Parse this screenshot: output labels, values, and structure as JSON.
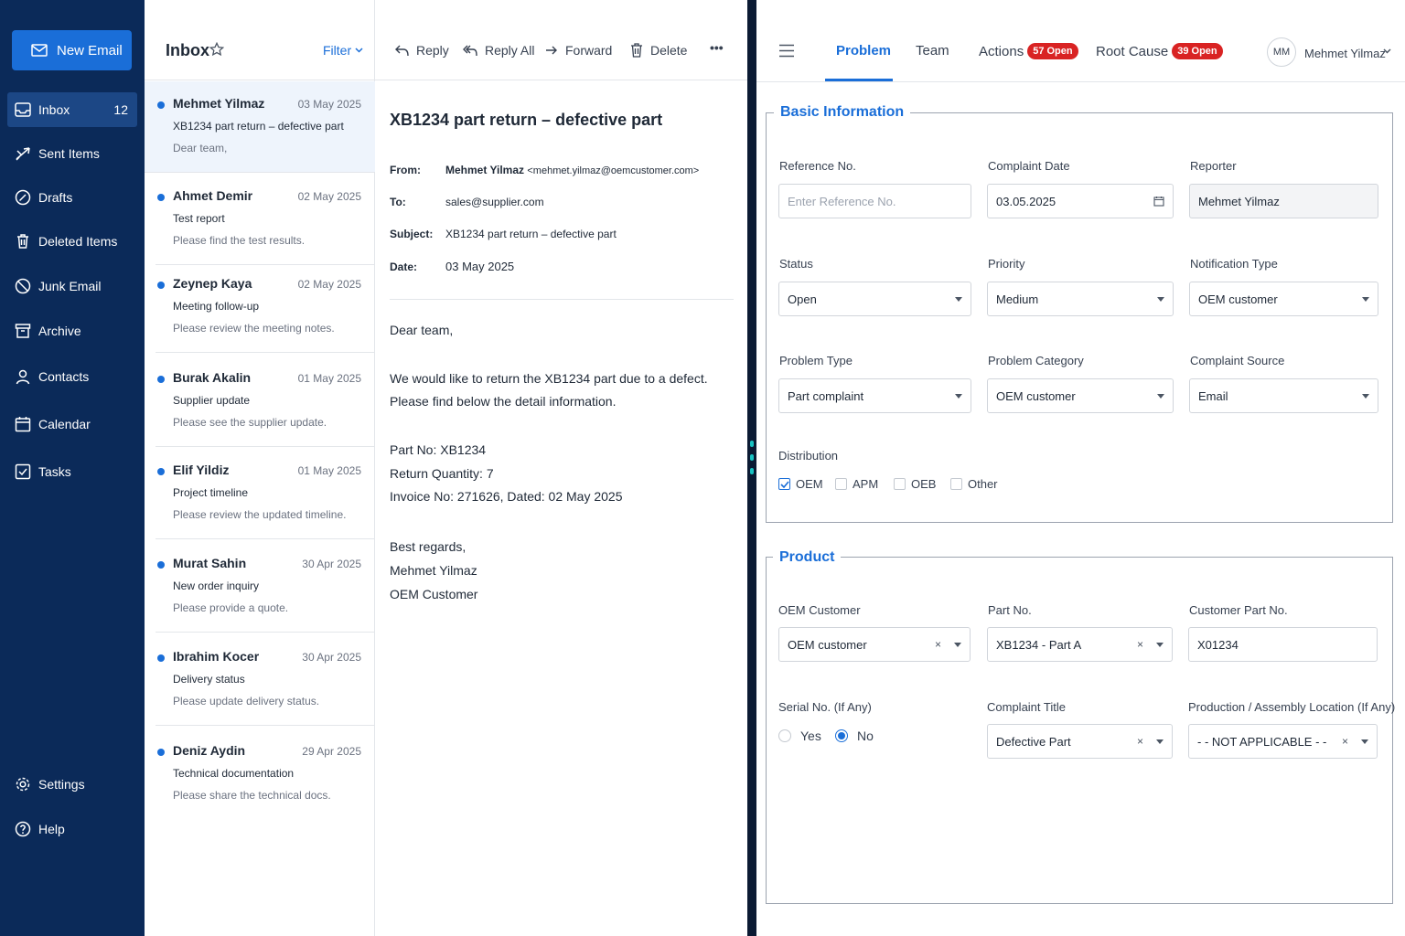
{
  "sidebar": {
    "new_email": "New Email",
    "items": [
      {
        "label": "Inbox",
        "count": "12",
        "icon": "inbox-icon"
      },
      {
        "label": "Sent Items",
        "icon": "send-icon"
      },
      {
        "label": "Drafts",
        "icon": "drafts-icon"
      },
      {
        "label": "Deleted Items",
        "icon": "trash-icon"
      },
      {
        "label": "Junk Email",
        "icon": "junk-icon"
      },
      {
        "label": "Archive",
        "icon": "archive-icon"
      },
      {
        "label": "Contacts",
        "icon": "contact-icon"
      },
      {
        "label": "Calendar",
        "icon": "calendar-icon"
      },
      {
        "label": "Tasks",
        "icon": "task-icon"
      }
    ],
    "settings": "Settings",
    "help": "Help"
  },
  "list": {
    "title": "Inbox",
    "filter": "Filter",
    "emails": [
      {
        "sender": "Mehmet Yilmaz",
        "date": "03 May 2025",
        "subject": "XB1234 part return – defective part",
        "preview": "Dear team,"
      },
      {
        "sender": "Ahmet Demir",
        "date": "02 May 2025",
        "subject": "Test report",
        "preview": "Please find the test results."
      },
      {
        "sender": "Zeynep Kaya",
        "date": "02 May 2025",
        "subject": "Meeting follow-up",
        "preview": "Please review the meeting notes."
      },
      {
        "sender": "Burak Akalin",
        "date": "01 May 2025",
        "subject": "Supplier update",
        "preview": "Please see the supplier update."
      },
      {
        "sender": "Elif Yildiz",
        "date": "01 May 2025",
        "subject": "Project timeline",
        "preview": "Please review the updated timeline."
      },
      {
        "sender": "Murat Sahin",
        "date": "30 Apr 2025",
        "subject": "New order inquiry",
        "preview": "Please provide a quote."
      },
      {
        "sender": "Ibrahim Kocer",
        "date": "30 Apr 2025",
        "subject": "Delivery status",
        "preview": "Please update delivery status."
      },
      {
        "sender": "Deniz Aydin",
        "date": "29 Apr 2025",
        "subject": "Technical documentation",
        "preview": "Please share the technical docs."
      }
    ]
  },
  "reader": {
    "toolbar": {
      "reply": "Reply",
      "reply_all": "Reply All",
      "forward": "Forward",
      "delete": "Delete",
      "more": "•••"
    },
    "subject": "XB1234 part return – defective part",
    "from_label": "From:",
    "from_name": "Mehmet Yilmaz",
    "from_email": "<mehmet.yilmaz@oemcustomer.com>",
    "to_label": "To:",
    "to": "sales@supplier.com",
    "subject_label": "Subject:",
    "subject_value": "XB1234 part return – defective part",
    "date_label": "Date:",
    "date": "03 May 2025",
    "body": [
      "Dear team,",
      "We would like to return the XB1234 part due to a defect.",
      "Please find below the detail information.",
      "Part No: XB1234",
      "Return Quantity: 7",
      "Invoice No: 271626, Dated: 02 May 2025",
      "Best regards,",
      "Mehmet Yilmaz",
      "OEM Customer"
    ]
  },
  "form": {
    "tabs": [
      {
        "label": "Problem"
      },
      {
        "label": "Team"
      },
      {
        "label": "Actions",
        "badge": "57 Open"
      },
      {
        "label": "Root Cause",
        "badge": "39 Open"
      }
    ],
    "user": {
      "initials": "MM",
      "name": "Mehmet Yilmaz"
    },
    "basic": {
      "title": "Basic Information",
      "reference_label": "Reference No.",
      "reference_placeholder": "Enter Reference No.",
      "complaint_date_label": "Complaint Date",
      "complaint_date": "03.05.2025",
      "reporter_label": "Reporter",
      "reporter": "Mehmet Yilmaz",
      "status_label": "Status",
      "status": "Open",
      "priority_label": "Priority",
      "priority": "Medium",
      "notification_type_label": "Notification Type",
      "notification_type": "OEM customer",
      "problem_type_label": "Problem Type",
      "problem_type": "Part complaint",
      "problem_category_label": "Problem Category",
      "problem_category": "OEM customer",
      "complaint_source_label": "Complaint Source",
      "complaint_source": "Email",
      "distribution_label": "Distribution",
      "distribution": [
        {
          "label": "OEM",
          "checked": true
        },
        {
          "label": "APM",
          "checked": false
        },
        {
          "label": "OEB",
          "checked": false
        },
        {
          "label": "Other",
          "checked": false
        }
      ]
    },
    "product": {
      "title": "Product",
      "oem_customer_label": "OEM Customer",
      "oem_customer": "OEM customer",
      "part_no_label": "Part No.",
      "part_no": "XB1234 - Part A",
      "customer_part_no_label": "Customer Part No.",
      "customer_part_no": "X01234",
      "serial_label": "Serial No. (If Any)",
      "serial_yes": "Yes",
      "serial_no": "No",
      "serial_selected": "No",
      "complaint_title_label": "Complaint Title",
      "complaint_title": "Defective Part",
      "location_label": "Production / Assembly Location (If Any)",
      "location": "- - NOT APPLICABLE - -",
      "clear_symbol": "×"
    }
  },
  "colors": {
    "sidebar": "#0b2a59",
    "accent": "#1a6ed8",
    "badge": "#d92323"
  }
}
